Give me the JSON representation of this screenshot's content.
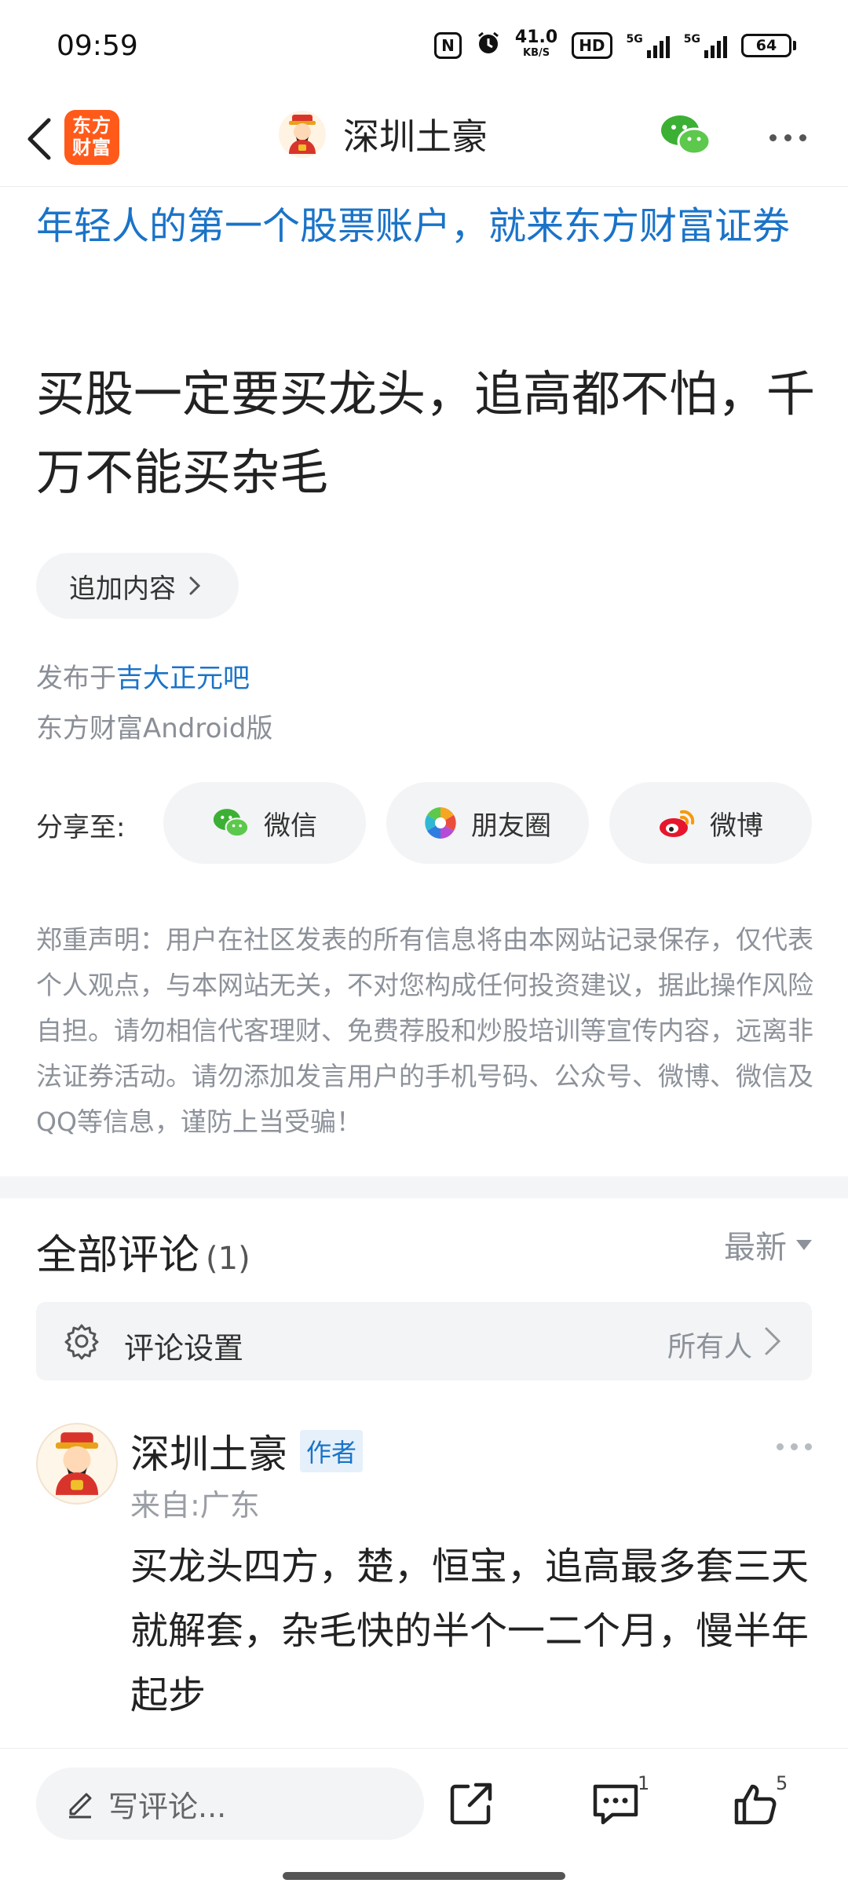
{
  "status_bar": {
    "time": "09:59",
    "nfc_label": "N",
    "net_speed": "41.0",
    "net_speed_unit": "KB/S",
    "hd_label": "HD",
    "sim1_label": "5G",
    "sim2_label": "5G",
    "battery": "64"
  },
  "header": {
    "app_logo_text": "东方财富",
    "title": "深圳土豪"
  },
  "post": {
    "ad_link": "年轻人的第一个股票账户，就来东方财富证券",
    "title": "买股一定要买龙头，追高都不怕，千万不能买杂毛",
    "append_label": "追加内容",
    "publish_prefix": "发布于",
    "publish_bar": "吉大正元吧",
    "client": "东方财富Android版"
  },
  "share": {
    "label": "分享至:",
    "wechat": "微信",
    "moments": "朋友圈",
    "weibo": "微博"
  },
  "disclaimer": "郑重声明：用户在社区发表的所有信息将由本网站记录保存，仅代表个人观点，与本网站无关，不对您构成任何投资建议，据此操作风险自担。请勿相信代客理财、免费荐股和炒股培训等宣传内容，远离非法证券活动。请勿添加发言用户的手机号码、公众号、微博、微信及QQ等信息，谨防上当受骗！",
  "comments": {
    "title": "全部评论",
    "count": "(1)",
    "sort": "最新",
    "settings_label": "评论设置",
    "settings_value": "所有人",
    "items": [
      {
        "author": "深圳土豪",
        "badge": "作者",
        "location": "来自:广东",
        "text": "买龙头四方，楚，恒宝，追高最多套三天就解套，杂毛快的半个一二个月，慢半年起步"
      }
    ]
  },
  "bottom_bar": {
    "comment_placeholder": "写评论...",
    "comment_count": "1",
    "like_count": "5"
  },
  "colors": {
    "link_blue": "#1a73c8",
    "app_orange": "#ff5a1a",
    "wechat_green": "#3cb034",
    "weibo_red": "#e6162d"
  }
}
